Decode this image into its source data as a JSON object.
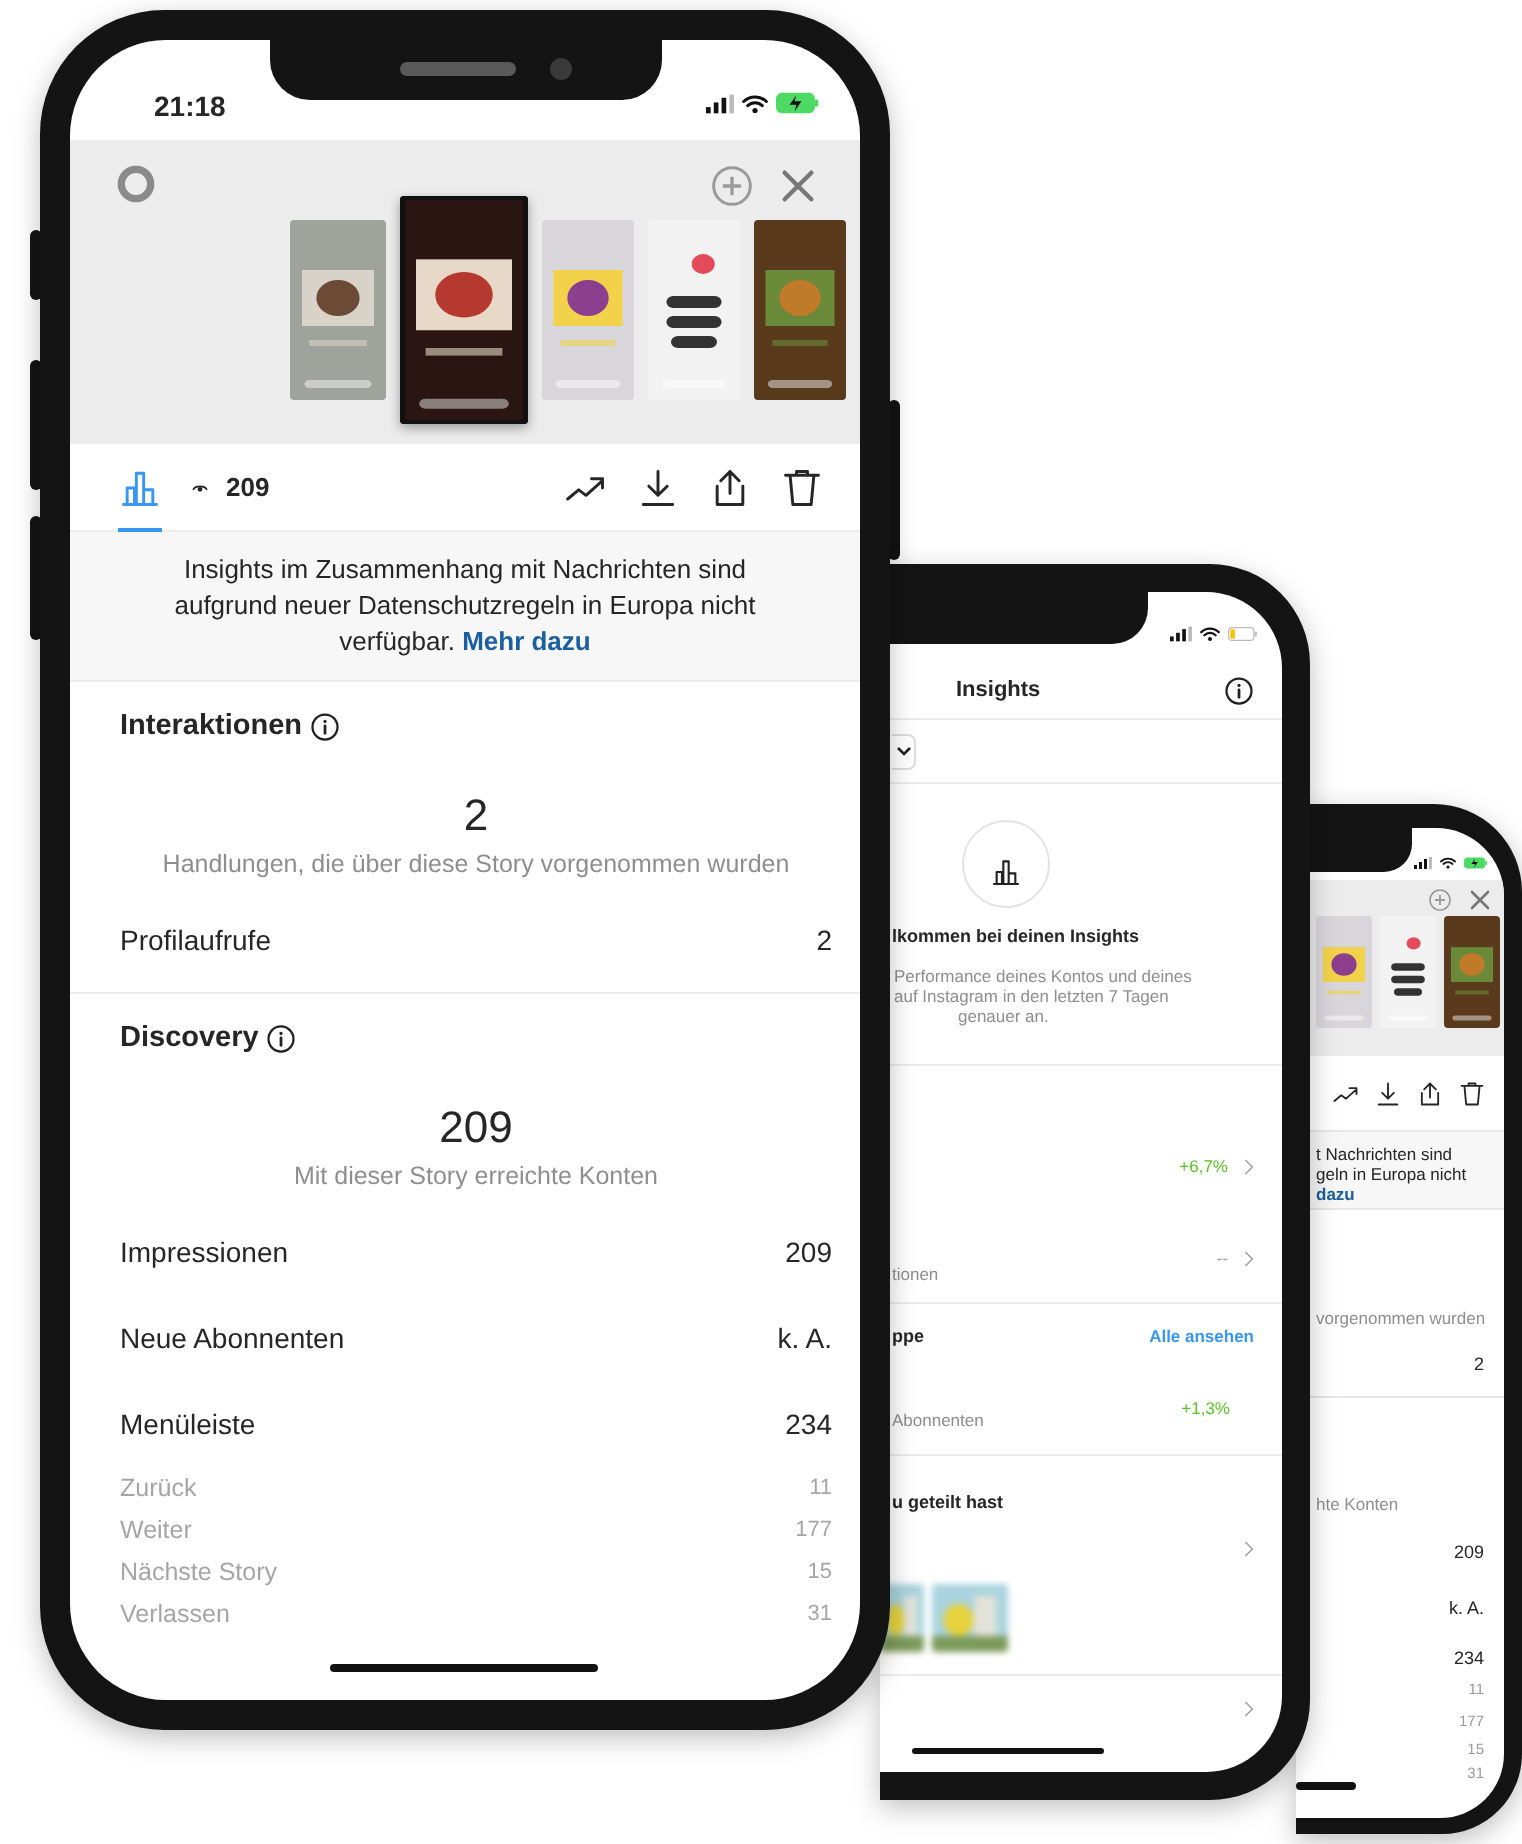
{
  "main_phone": {
    "status_bar": {
      "time": "21:18"
    },
    "stories": [
      {
        "kind": "picture",
        "selected": false
      },
      {
        "kind": "picture",
        "selected": true
      },
      {
        "kind": "picture",
        "selected": false
      },
      {
        "kind": "picture",
        "selected": false
      },
      {
        "kind": "picture",
        "selected": false
      }
    ],
    "toolbar": {
      "insights_tab": {
        "selected": true
      },
      "view_count": "209",
      "actions": [
        {
          "kind": "trend"
        },
        {
          "kind": "download"
        },
        {
          "kind": "share"
        },
        {
          "kind": "delete"
        }
      ]
    },
    "notice": {
      "text": "Insights im Zusammenhang mit Nachrichten sind aufgrund neuer Datenschutzregeln in Europa nicht verfügbar.",
      "link": "Mehr dazu"
    },
    "sections": [
      {
        "title": "Interaktionen",
        "total": "2",
        "caption": "Handlungen, die über diese Story vorgenommen wurden",
        "rows": [
          {
            "kind": "main",
            "label": "Profilaufrufe",
            "value": "2"
          }
        ]
      },
      {
        "title": "Discovery",
        "total": "209",
        "caption": "Mit dieser Story erreichte Konten",
        "rows": [
          {
            "kind": "main",
            "label": "Impressionen",
            "value": "209"
          },
          {
            "kind": "main",
            "label": "Neue Abonnenten",
            "value": "k. A."
          },
          {
            "kind": "main",
            "label": "Menüleiste",
            "value": "234"
          },
          {
            "kind": "sub",
            "label": "Zurück",
            "value": "11"
          },
          {
            "kind": "sub",
            "label": "Weiter",
            "value": "177"
          },
          {
            "kind": "sub",
            "label": "Nächste Story",
            "value": "15"
          },
          {
            "kind": "sub",
            "label": "Verlassen",
            "value": "31"
          }
        ]
      }
    ]
  },
  "middle_phone": {
    "title": "Insights",
    "welcome": {
      "title": "lkommen bei deinen Insights",
      "lines": [
        "Performance deines Kontos und deines",
        "auf Instagram in den letzten 7 Tagen",
        "genauer an."
      ]
    },
    "metrics": [
      {
        "value": "+6,7%",
        "positive": true
      },
      {
        "caption": "tionen",
        "value": "--",
        "positive": false
      }
    ],
    "audience": {
      "title": "ppe",
      "link": "Alle ansehen",
      "caption": "Abonnenten",
      "value": "+1,3%",
      "positive": true
    },
    "shared": {
      "title": "u geteilt hast",
      "thumbnails": [
        {
          "kind": "picture"
        },
        {
          "kind": "picture"
        }
      ]
    }
  },
  "back_phone": {
    "stories": [
      {
        "kind": "picture"
      },
      {
        "kind": "picture"
      },
      {
        "kind": "picture"
      }
    ],
    "notice_lines": [
      "t Nachrichten sind",
      "geln in Europa nicht"
    ],
    "notice_link": "dazu",
    "caption_1": "vorgenommen wurden",
    "value_1": "2",
    "caption_2": "hte Konten",
    "values": [
      {
        "kind": "main",
        "value": "209"
      },
      {
        "kind": "main",
        "value": "k. A."
      },
      {
        "kind": "main",
        "value": "234"
      },
      {
        "kind": "sub",
        "value": "11"
      },
      {
        "kind": "sub",
        "value": "177"
      },
      {
        "kind": "sub",
        "value": "15"
      },
      {
        "kind": "sub",
        "value": "31"
      }
    ]
  }
}
